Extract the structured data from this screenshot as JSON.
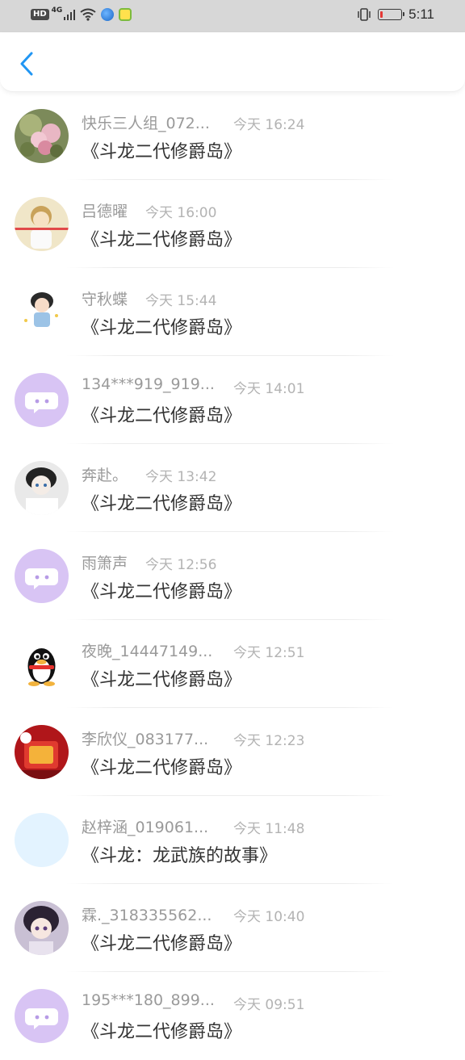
{
  "status_bar": {
    "hd": "HD",
    "network": "4G",
    "time": "5:11",
    "battery_level": 0.1,
    "battery_color": "#e53935"
  },
  "header": {
    "back_icon": "chevron-left-icon",
    "accent_color": "#2196f3"
  },
  "messages": [
    {
      "name": "快乐三人组_072...",
      "time": "今天 16:24",
      "title": "《斗龙二代修爵岛》",
      "avatar": "flower-photo"
    },
    {
      "name": "吕德曜",
      "time": "今天 16:00",
      "title": "《斗龙二代修爵岛》",
      "avatar": "anime-boy-photo"
    },
    {
      "name": "守秋蝶",
      "time": "今天 15:44",
      "title": "《斗龙二代修爵岛》",
      "avatar": "cartoon-girl-photo"
    },
    {
      "name": "134***919_919...",
      "time": "今天 14:01",
      "title": "《斗龙二代修爵岛》",
      "avatar": "default-chat-bubble"
    },
    {
      "name": "奔赴。",
      "time": "今天 13:42",
      "title": "《斗龙二代修爵岛》",
      "avatar": "anime-face-photo"
    },
    {
      "name": "雨箫声",
      "time": "今天 12:56",
      "title": "《斗龙二代修爵岛》",
      "avatar": "default-chat-bubble"
    },
    {
      "name": "夜晚_14447149...",
      "time": "今天 12:51",
      "title": "《斗龙二代修爵岛》",
      "avatar": "qq-penguin"
    },
    {
      "name": "李欣仪_083177...",
      "time": "今天 12:23",
      "title": "《斗龙二代修爵岛》",
      "avatar": "red-object-photo"
    },
    {
      "name": "赵梓涵_019061...",
      "time": "今天 11:48",
      "title": "《斗龙：龙武族的故事》",
      "avatar": "blank-light-blue"
    },
    {
      "name": "霖._318335562...",
      "time": "今天 10:40",
      "title": "《斗龙二代修爵岛》",
      "avatar": "anime-character-photo"
    },
    {
      "name": "195***180_899...",
      "time": "今天 09:51",
      "title": "《斗龙二代修爵岛》",
      "avatar": "default-chat-bubble"
    }
  ]
}
